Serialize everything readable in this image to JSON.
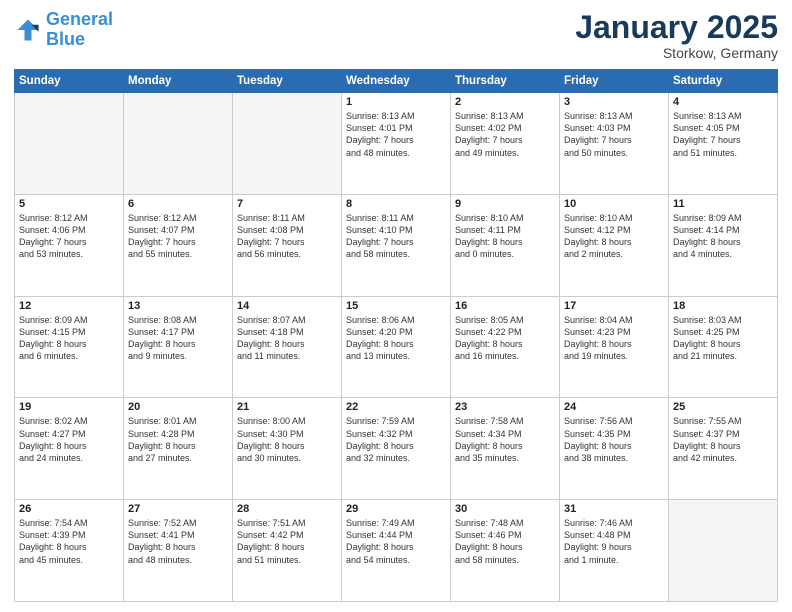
{
  "header": {
    "logo_line1": "General",
    "logo_line2": "Blue",
    "month_title": "January 2025",
    "location": "Storkow, Germany"
  },
  "weekdays": [
    "Sunday",
    "Monday",
    "Tuesday",
    "Wednesday",
    "Thursday",
    "Friday",
    "Saturday"
  ],
  "weeks": [
    [
      {
        "day": "",
        "text": ""
      },
      {
        "day": "",
        "text": ""
      },
      {
        "day": "",
        "text": ""
      },
      {
        "day": "1",
        "text": "Sunrise: 8:13 AM\nSunset: 4:01 PM\nDaylight: 7 hours\nand 48 minutes."
      },
      {
        "day": "2",
        "text": "Sunrise: 8:13 AM\nSunset: 4:02 PM\nDaylight: 7 hours\nand 49 minutes."
      },
      {
        "day": "3",
        "text": "Sunrise: 8:13 AM\nSunset: 4:03 PM\nDaylight: 7 hours\nand 50 minutes."
      },
      {
        "day": "4",
        "text": "Sunrise: 8:13 AM\nSunset: 4:05 PM\nDaylight: 7 hours\nand 51 minutes."
      }
    ],
    [
      {
        "day": "5",
        "text": "Sunrise: 8:12 AM\nSunset: 4:06 PM\nDaylight: 7 hours\nand 53 minutes."
      },
      {
        "day": "6",
        "text": "Sunrise: 8:12 AM\nSunset: 4:07 PM\nDaylight: 7 hours\nand 55 minutes."
      },
      {
        "day": "7",
        "text": "Sunrise: 8:11 AM\nSunset: 4:08 PM\nDaylight: 7 hours\nand 56 minutes."
      },
      {
        "day": "8",
        "text": "Sunrise: 8:11 AM\nSunset: 4:10 PM\nDaylight: 7 hours\nand 58 minutes."
      },
      {
        "day": "9",
        "text": "Sunrise: 8:10 AM\nSunset: 4:11 PM\nDaylight: 8 hours\nand 0 minutes."
      },
      {
        "day": "10",
        "text": "Sunrise: 8:10 AM\nSunset: 4:12 PM\nDaylight: 8 hours\nand 2 minutes."
      },
      {
        "day": "11",
        "text": "Sunrise: 8:09 AM\nSunset: 4:14 PM\nDaylight: 8 hours\nand 4 minutes."
      }
    ],
    [
      {
        "day": "12",
        "text": "Sunrise: 8:09 AM\nSunset: 4:15 PM\nDaylight: 8 hours\nand 6 minutes."
      },
      {
        "day": "13",
        "text": "Sunrise: 8:08 AM\nSunset: 4:17 PM\nDaylight: 8 hours\nand 9 minutes."
      },
      {
        "day": "14",
        "text": "Sunrise: 8:07 AM\nSunset: 4:18 PM\nDaylight: 8 hours\nand 11 minutes."
      },
      {
        "day": "15",
        "text": "Sunrise: 8:06 AM\nSunset: 4:20 PM\nDaylight: 8 hours\nand 13 minutes."
      },
      {
        "day": "16",
        "text": "Sunrise: 8:05 AM\nSunset: 4:22 PM\nDaylight: 8 hours\nand 16 minutes."
      },
      {
        "day": "17",
        "text": "Sunrise: 8:04 AM\nSunset: 4:23 PM\nDaylight: 8 hours\nand 19 minutes."
      },
      {
        "day": "18",
        "text": "Sunrise: 8:03 AM\nSunset: 4:25 PM\nDaylight: 8 hours\nand 21 minutes."
      }
    ],
    [
      {
        "day": "19",
        "text": "Sunrise: 8:02 AM\nSunset: 4:27 PM\nDaylight: 8 hours\nand 24 minutes."
      },
      {
        "day": "20",
        "text": "Sunrise: 8:01 AM\nSunset: 4:28 PM\nDaylight: 8 hours\nand 27 minutes."
      },
      {
        "day": "21",
        "text": "Sunrise: 8:00 AM\nSunset: 4:30 PM\nDaylight: 8 hours\nand 30 minutes."
      },
      {
        "day": "22",
        "text": "Sunrise: 7:59 AM\nSunset: 4:32 PM\nDaylight: 8 hours\nand 32 minutes."
      },
      {
        "day": "23",
        "text": "Sunrise: 7:58 AM\nSunset: 4:34 PM\nDaylight: 8 hours\nand 35 minutes."
      },
      {
        "day": "24",
        "text": "Sunrise: 7:56 AM\nSunset: 4:35 PM\nDaylight: 8 hours\nand 38 minutes."
      },
      {
        "day": "25",
        "text": "Sunrise: 7:55 AM\nSunset: 4:37 PM\nDaylight: 8 hours\nand 42 minutes."
      }
    ],
    [
      {
        "day": "26",
        "text": "Sunrise: 7:54 AM\nSunset: 4:39 PM\nDaylight: 8 hours\nand 45 minutes."
      },
      {
        "day": "27",
        "text": "Sunrise: 7:52 AM\nSunset: 4:41 PM\nDaylight: 8 hours\nand 48 minutes."
      },
      {
        "day": "28",
        "text": "Sunrise: 7:51 AM\nSunset: 4:42 PM\nDaylight: 8 hours\nand 51 minutes."
      },
      {
        "day": "29",
        "text": "Sunrise: 7:49 AM\nSunset: 4:44 PM\nDaylight: 8 hours\nand 54 minutes."
      },
      {
        "day": "30",
        "text": "Sunrise: 7:48 AM\nSunset: 4:46 PM\nDaylight: 8 hours\nand 58 minutes."
      },
      {
        "day": "31",
        "text": "Sunrise: 7:46 AM\nSunset: 4:48 PM\nDaylight: 9 hours\nand 1 minute."
      },
      {
        "day": "",
        "text": ""
      }
    ]
  ]
}
